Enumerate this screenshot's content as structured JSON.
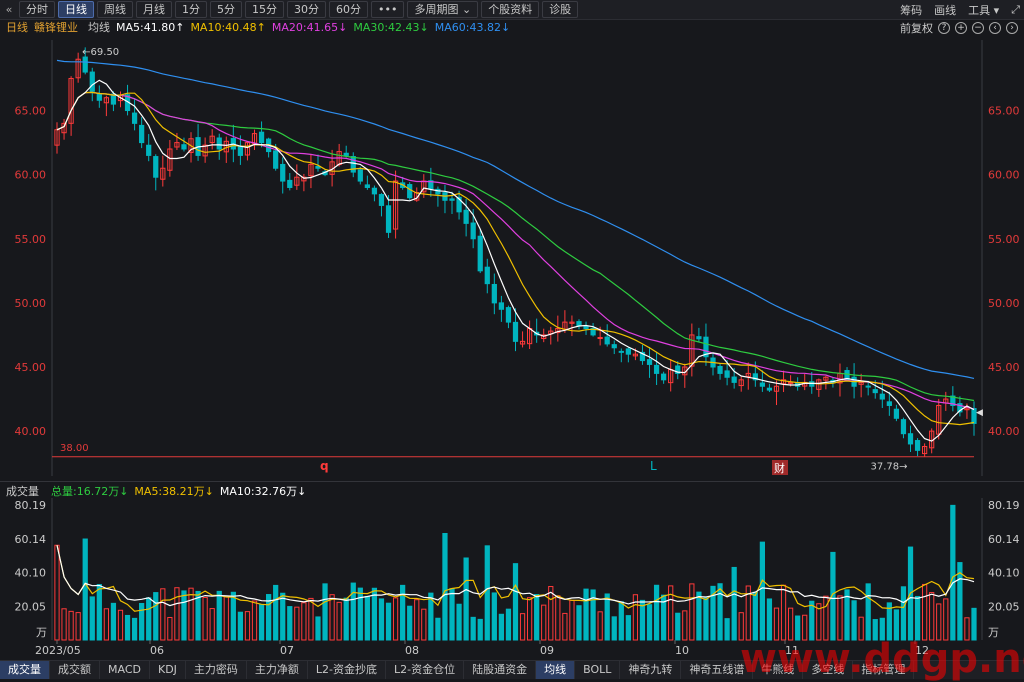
{
  "topbar": {
    "back_icon": "«",
    "tabs": [
      "分时",
      "日线",
      "周线",
      "月线",
      "1分",
      "5分",
      "15分",
      "30分",
      "60分",
      "•••",
      "多周期图 ⌄",
      "个股资料",
      "诊股"
    ],
    "active_tab": 1,
    "right": [
      "筹码",
      "画线",
      "工具 ▾"
    ],
    "window_icons": [
      "⤢",
      "⤡"
    ]
  },
  "legend": {
    "period": "日线",
    "name": "赣锋锂业",
    "avg": "均线",
    "ma5": "MA5:41.80↑",
    "ma10": "MA10:40.48↑",
    "ma20": "MA20:41.65↓",
    "ma30": "MA30:42.43↓",
    "ma60": "MA60:43.82↓",
    "fq": "前复权"
  },
  "colors": {
    "up": "#ff3a3a",
    "down": "#00b5bf",
    "ma5": "#ffffff",
    "ma10": "#f0c000",
    "ma20": "#e040e0",
    "ma30": "#2ecc40",
    "ma60": "#2f8ff0",
    "axis": "#e23a3a"
  },
  "price_axis": {
    "ticks": [
      "65.00",
      "60.00",
      "55.00",
      "50.00",
      "45.00",
      "40.00"
    ],
    "tick_values": [
      65,
      60,
      55,
      50,
      45,
      40
    ],
    "range": [
      36.5,
      70.5
    ]
  },
  "annotations": {
    "high": "69.50",
    "low": "37.78→",
    "line_label": "38.00",
    "line_value": 38.0,
    "mark_q": "q",
    "mark_l": "L",
    "mark_cai": "财"
  },
  "volume_legend": {
    "title": "成交量",
    "total": "总量:16.72万↓",
    "ma5": "MA5:38.21万↓",
    "ma10": "MA10:32.76万↓"
  },
  "volume_axis": {
    "ticks": [
      "80.19",
      "60.14",
      "40.10",
      "20.05"
    ],
    "tick_values": [
      80.19,
      60.14,
      40.1,
      20.05
    ],
    "unit": "万",
    "max": 82
  },
  "x_axis": {
    "labels": [
      "2023/05",
      "06",
      "07",
      "08",
      "09",
      "10",
      "11",
      "12"
    ]
  },
  "bottom_tabs": [
    "成交量",
    "成交额",
    "MACD",
    "KDJ",
    "主力密码",
    "主力净额",
    "L2-资金抄底",
    "L2-资金仓位",
    "陆股通资金",
    "均线",
    "BOLL",
    "神奇九转",
    "神奇五线谱",
    "牛熊线",
    "多空线",
    "指标管理"
  ],
  "watermark": "www.ddgp.net",
  "chart_data": {
    "type": "candlestick",
    "title": "赣锋锂业 日线",
    "x_labels": [
      "2023/05",
      "06",
      "07",
      "08",
      "09",
      "10",
      "11",
      "12"
    ],
    "closes": [
      63.5,
      64.0,
      67.5,
      69.0,
      68.0,
      66.5,
      65.8,
      66.0,
      65.5,
      66.2,
      65.0,
      64.0,
      62.5,
      61.5,
      59.8,
      60.5,
      62.0,
      62.5,
      62.0,
      62.8,
      61.5,
      62.3,
      63.0,
      62.0,
      62.6,
      62.0,
      61.5,
      62.5,
      63.2,
      62.5,
      61.8,
      60.5,
      59.5,
      59.0,
      59.8,
      59.8,
      60.8,
      60.5,
      60.0,
      61.0,
      61.8,
      61.5,
      60.2,
      59.5,
      59.0,
      58.5,
      57.6,
      55.5,
      59.5,
      59.0,
      58.2,
      58.6,
      59.5,
      58.9,
      58.5,
      58.0,
      58.0,
      57.1,
      56.2,
      55.0,
      52.5,
      51.5,
      50.0,
      49.5,
      48.5,
      47.0,
      47.0,
      48.0,
      47.5,
      47.5,
      47.8,
      48.0,
      48.5,
      48.5,
      48.2,
      48.0,
      47.5,
      47.3,
      46.8,
      46.5,
      46.2,
      46.0,
      46.0,
      45.5,
      45.2,
      44.5,
      44.0,
      44.8,
      44.5,
      45.0,
      47.5,
      47.2,
      45.8,
      45.0,
      44.5,
      44.2,
      43.8,
      44.0,
      44.5,
      44.0,
      43.5,
      43.2,
      43.5,
      44.0,
      43.8,
      43.5,
      43.8,
      43.5,
      44.0,
      44.2,
      43.8,
      44.5,
      44.0,
      43.5,
      43.8,
      43.5,
      43.0,
      42.5,
      42.0,
      41.0,
      39.8,
      39.0,
      38.5,
      38.8,
      40.0,
      42.0,
      42.5,
      42.0,
      41.5,
      41.8,
      40.6
    ],
    "volume_ma5": 38.21,
    "volume_ma10": 32.76
  }
}
